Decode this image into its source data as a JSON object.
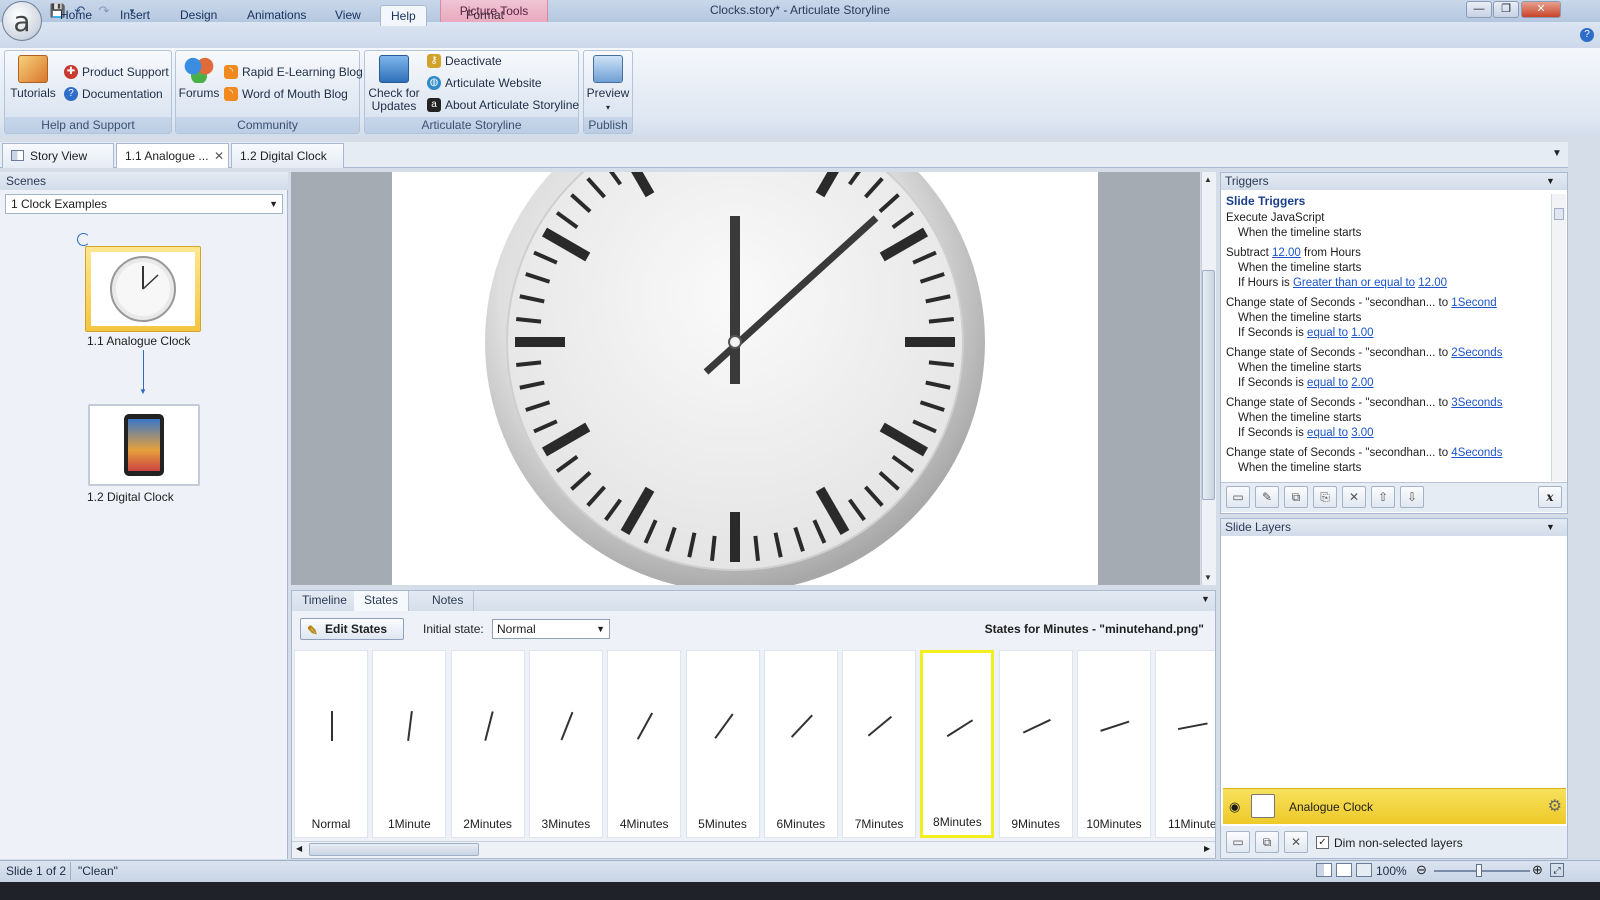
{
  "window": {
    "title": "Clocks.story* -  Articulate Storyline",
    "contextual_tab_group": "Picture Tools",
    "minimize": "—",
    "restore": "❐",
    "close": "✕",
    "help": "?"
  },
  "ribbon_tabs": [
    "Home",
    "Insert",
    "Design",
    "Animations",
    "View",
    "Help",
    "Format"
  ],
  "ribbon": {
    "help_support": {
      "label": "Help and Support",
      "tutorials": "Tutorials",
      "product_support": "Product Support",
      "documentation": "Documentation"
    },
    "community": {
      "label": "Community",
      "forums": "Forums",
      "rapid_blog": "Rapid E-Learning Blog",
      "wom_blog": "Word of Mouth Blog"
    },
    "articulate": {
      "label": "Articulate Storyline",
      "check_updates_1": "Check for",
      "check_updates_2": "Updates",
      "deactivate": "Deactivate",
      "website": "Articulate Website",
      "about": "About Articulate Storyline"
    },
    "publish": {
      "label": "Publish",
      "preview": "Preview"
    }
  },
  "doc_tabs": {
    "story_view": "Story View",
    "tab1": "1.1 Analogue ...",
    "tab2": "1.2 Digital Clock"
  },
  "scenes": {
    "header": "Scenes",
    "selected_scene": "1 Clock Examples",
    "slide1": "1.1 Analogue Clock",
    "slide2": "1.2 Digital Clock"
  },
  "bottom_tabs": [
    "Timeline",
    "States",
    "Notes"
  ],
  "states": {
    "edit_button": "Edit States",
    "initial_label": "Initial state:",
    "initial_value": "Normal",
    "title": "States for Minutes - \"minutehand.png\"",
    "items": [
      "Normal",
      "1Minute",
      "2Minutes",
      "3Minutes",
      "4Minutes",
      "5Minutes",
      "6Minutes",
      "7Minutes",
      "8Minutes",
      "9Minutes",
      "10Minutes",
      "11Minute"
    ],
    "selected": "8Minutes"
  },
  "triggers": {
    "header": "Triggers",
    "section_title": "Slide Triggers",
    "t1_action": "Execute JavaScript",
    "t1_when": "When the timeline starts",
    "t2_action_pre": "Subtract",
    "t2_value": "12.00",
    "t2_action_post": "from Hours",
    "t2_when": "When the timeline starts",
    "t2_cond_pre": "If Hours is",
    "t2_cond_op": "Greater than or equal to",
    "t2_cond_val": "12.00",
    "t3_action": "Change state of Seconds - \"secondhan... to",
    "t3_state": "1Second",
    "t3_when": "When the timeline starts",
    "t3_cond_pre": "If Seconds is",
    "t3_cond_op": "equal to",
    "t3_cond_val": "1.00",
    "t4_action": "Change state of Seconds - \"secondhan... to",
    "t4_state": "2Seconds",
    "t4_when": "When the timeline starts",
    "t4_cond_pre": "If Seconds is",
    "t4_cond_op": "equal to",
    "t4_cond_val": "2.00",
    "t5_action": "Change state of Seconds - \"secondhan... to",
    "t5_state": "3Seconds",
    "t5_when": "When the timeline starts",
    "t5_cond_pre": "If Seconds is",
    "t5_cond_op": "equal to",
    "t5_cond_val": "3.00",
    "t6_action": "Change state of Seconds - \"secondhan... to",
    "t6_state": "4Seconds",
    "t6_when": "When the timeline starts"
  },
  "layers": {
    "header": "Slide Layers",
    "base_layer": "Analogue Clock",
    "dim_label": "Dim non-selected layers",
    "dim_checked": true
  },
  "status": {
    "slide_of": "Slide 1 of 2",
    "theme": "\"Clean\"",
    "zoom": "100%"
  }
}
